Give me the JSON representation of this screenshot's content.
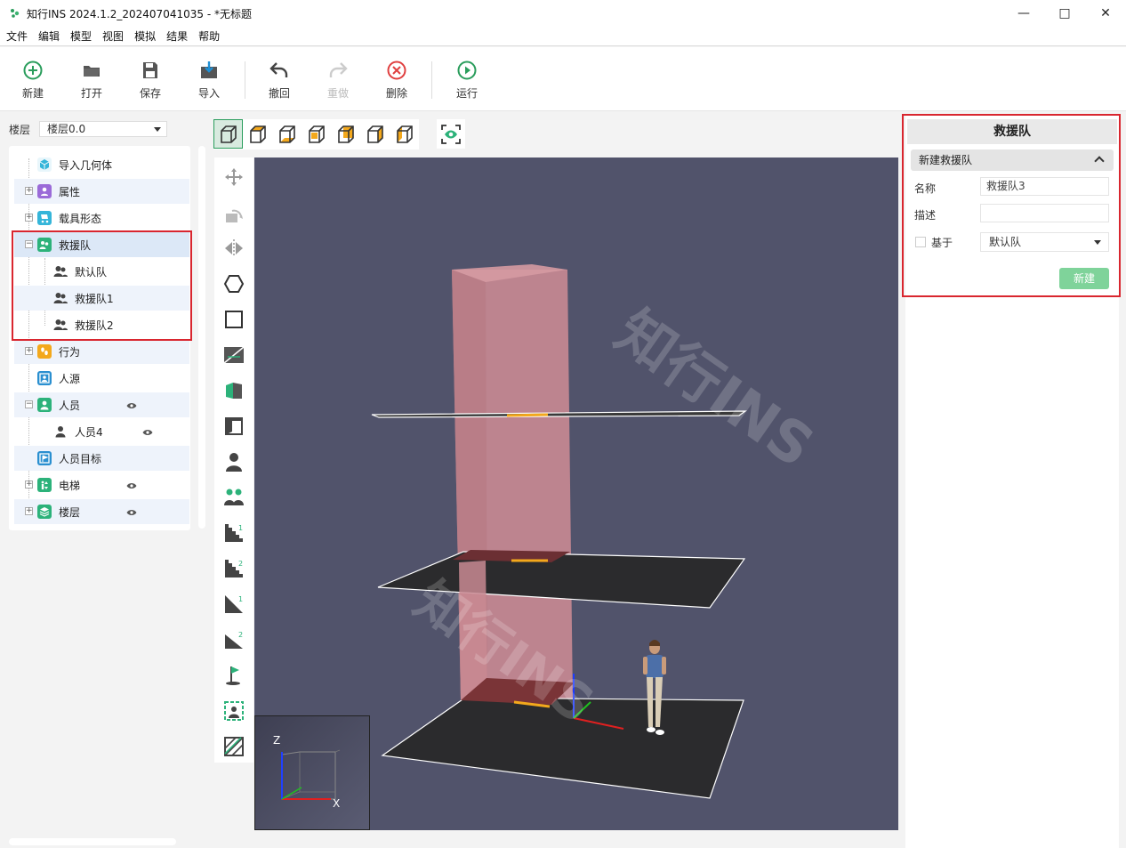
{
  "window": {
    "title": "知行INS 2024.1.2_202407041035 - *无标题",
    "controls": [
      "minimize",
      "maximize",
      "close"
    ]
  },
  "menu": [
    "文件",
    "编辑",
    "模型",
    "视图",
    "模拟",
    "结果",
    "帮助"
  ],
  "toolbar": {
    "new": "新建",
    "open": "打开",
    "save": "保存",
    "import": "导入",
    "undo": "撤回",
    "redo": "重做",
    "delete": "删除",
    "run": "运行"
  },
  "floor": {
    "label": "楼层",
    "value": "楼层0.0"
  },
  "tree": {
    "import_geometry": "导入几何体",
    "attributes": "属性",
    "vehicle_shape": "载具形态",
    "rescue_team": "救援队",
    "default_team": "默认队",
    "rescue_team_1": "救援队1",
    "rescue_team_2": "救援队2",
    "behavior": "行为",
    "people_source": "人源",
    "people": "人员",
    "person_4": "人员4",
    "people_target": "人员目标",
    "elevator": "电梯",
    "floors": "楼层"
  },
  "viewport": {
    "axis_z": "Z",
    "axis_x": "X",
    "watermark": "知行INS"
  },
  "panel": {
    "title": "救援队",
    "section": "新建救援队",
    "name_label": "名称",
    "name_value": "救援队3",
    "desc_label": "描述",
    "desc_value": "",
    "based_label": "基于",
    "based_value": "默认队",
    "create_button": "新建"
  },
  "colors": {
    "accent": "#2a9d5c",
    "highlight": "#d9262f",
    "viewport_bg": "#51536b",
    "button_green": "#7fd39a"
  }
}
